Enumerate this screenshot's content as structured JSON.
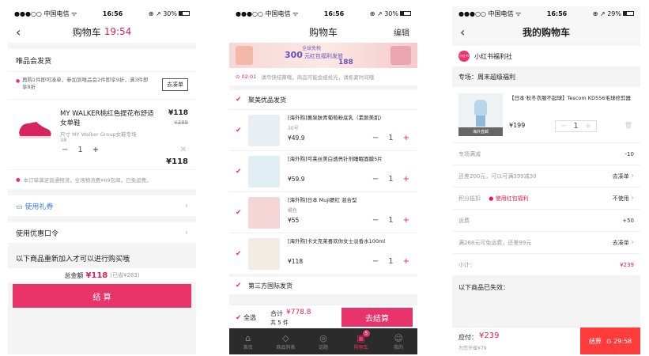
{
  "s1": {
    "status": {
      "carrier": "●●●○○ 中国电信 ᯤ",
      "time": "16:56",
      "right": "⊕ ↗ 30%"
    },
    "nav": {
      "title": "购物车",
      "timer": "19:54"
    },
    "section_title": "唯品会发货",
    "promo": {
      "text": "再购1件即可凑单，参加到唯品会2件即享9折，满3件即享8折",
      "button": "去凑单"
    },
    "item": {
      "name": "MY WALKER桃红色提花布舒适女单鞋",
      "price": "¥118",
      "orig": "¥389",
      "spec": "尺寸 MY Walker Group女鞋专场",
      "size": "38",
      "qty": "1",
      "subtotal": "¥118"
    },
    "notice": "本订单满足普通物流，全场物流费¥69包邮，已免运费。",
    "coupon": "使用礼券",
    "code": "使用优惠口令",
    "readd": "以下商品重新加入才可以进行购买哦",
    "total_label": "总金额",
    "total": "¥118",
    "total_note": "(已省¥283)",
    "checkout": "结 算"
  },
  "s2": {
    "status": {
      "carrier": "●●●○○ 中国电信 ᯤ",
      "time": "16:56",
      "right": "⊕ ↗ 30%"
    },
    "nav": {
      "title": "购物车",
      "edit": "编辑"
    },
    "banner": {
      "tag": "全球免税",
      "amount": "300",
      "sub": "元红包福利发放",
      "amount2": "188"
    },
    "timer": {
      "time": "⊙ 02:01",
      "text": "请尽快结算哦，商品可能会被抢光，请抓紧时间哦"
    },
    "group1": "聚美优品发货",
    "items": [
      {
        "name": "[海外购]蕙泉肤青葡萄粉底乳（素颜美肌）",
        "sub": "30号",
        "price": "¥49.9",
        "qty": "1"
      },
      {
        "name": "[海外购]可莱丝美白透亮针剂睡眠面膜5片",
        "sub": "",
        "price": "¥59.9",
        "qty": "1"
      },
      {
        "name": "[海外购]日本 Muji腮红 混合型",
        "sub": "橘色",
        "price": "¥55",
        "qty": "1"
      },
      {
        "name": "[海外购]卡文克莱喜欢你女士淡香水100ml",
        "sub": "",
        "price": "¥118",
        "qty": "1"
      }
    ],
    "group2": "第三方国际发货",
    "footer": {
      "select_all": "全选",
      "total_label": "合计",
      "total": "¥778.8",
      "count": "共 5 件",
      "checkout": "去结算"
    },
    "tabs": [
      "首页",
      "商品列表",
      "话题",
      "购物车",
      "我的"
    ],
    "badge": "5"
  },
  "s3": {
    "status": {
      "carrier": "●●●○○ 中国电信 ᯤ",
      "time": "16:56",
      "right": "⊕ ↗ 29%"
    },
    "nav": {
      "title": "我的购物车"
    },
    "shop": {
      "logo": "小红书",
      "name": "小红书福利社"
    },
    "zone": "专场：周末超级福利",
    "item": {
      "name": "【日本·秋冬衣服不起球】Tescom KD556毛球修剪器",
      "price": "¥199",
      "qty": "1",
      "tag": "海外直邮"
    },
    "rows": [
      {
        "label": "专场满减",
        "value": "-10",
        "link": false
      },
      {
        "label": "还差200元，可以可满399减30",
        "value": "去凑单",
        "link": true
      },
      {
        "label": "积分抵扣",
        "badge": "使用红包福利",
        "value": "不使用",
        "link": true
      },
      {
        "label": "运费",
        "value": "+50",
        "link": false
      },
      {
        "label": "满268元可免运费，还差99元",
        "value": "去凑单",
        "link": true
      },
      {
        "label": "小计：",
        "value": "¥239",
        "link": false
      }
    ],
    "expired": "以下商品已失效：",
    "footer": {
      "label": "应付：",
      "total": "¥239",
      "note": "为您节省¥79",
      "checkout": "结算",
      "timer": "⊙ 29:58"
    }
  }
}
